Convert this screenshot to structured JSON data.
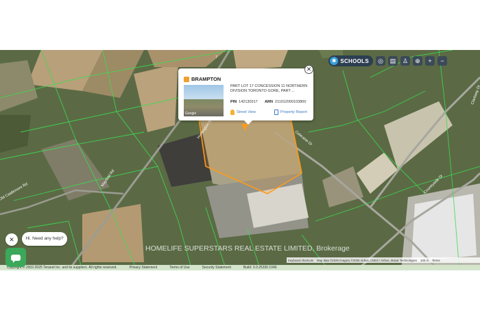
{
  "toolbar": {
    "schools_label": "SCHOOLS",
    "tools": [
      "layers-icon",
      "map-icon",
      "person-icon",
      "locate-icon",
      "zoom-in-icon",
      "zoom-out-icon"
    ],
    "zoom_in": "+",
    "zoom_out": "−"
  },
  "popup": {
    "title": "BRAMPTON",
    "description": "PART LOT 17 CONCESSION 11 NORTHERN DIVISION TORONTO GORE, PART ...",
    "pin_label": "PIN",
    "pin_value": "142130317",
    "arn_label": "ARN",
    "arn_value": "211012000103800",
    "street_view": "Street View",
    "property_report": "Property Report",
    "photo_brand": "Google",
    "close": "✕"
  },
  "map": {
    "road_labels": [
      "Huntington Rd",
      "Mayfield Rd",
      "Coleraine Dr",
      "Countryside Dr",
      "Old Castlemore Rd",
      "Clarkway Dr",
      "7"
    ],
    "watermark": "HOMELIFE SUPERSTARS REAL ESTATE LIMITED, Brokerage",
    "keyboard": "Keyboard shortcuts",
    "map_data": "Map data ©2025 Imagery ©2025 Airbus, CNES / Airbus, Maxar Technologies",
    "scale": "100 m",
    "terms": "Terms"
  },
  "footer": {
    "copyright": "Copyright © 2002-2025 Teranet Inc. and its suppliers. All rights reserved.",
    "links": [
      "Privacy Statement",
      "Terms of Use",
      "Security Statement",
      "Build: 3.0.25330.1046"
    ]
  },
  "chat": {
    "close": "✕",
    "prompt": "Hi. Need any help?"
  },
  "colors": {
    "parcel_line": "#3ddc52",
    "selected_parcel": "#ff9a1a",
    "popup_link": "#3c78c8"
  }
}
